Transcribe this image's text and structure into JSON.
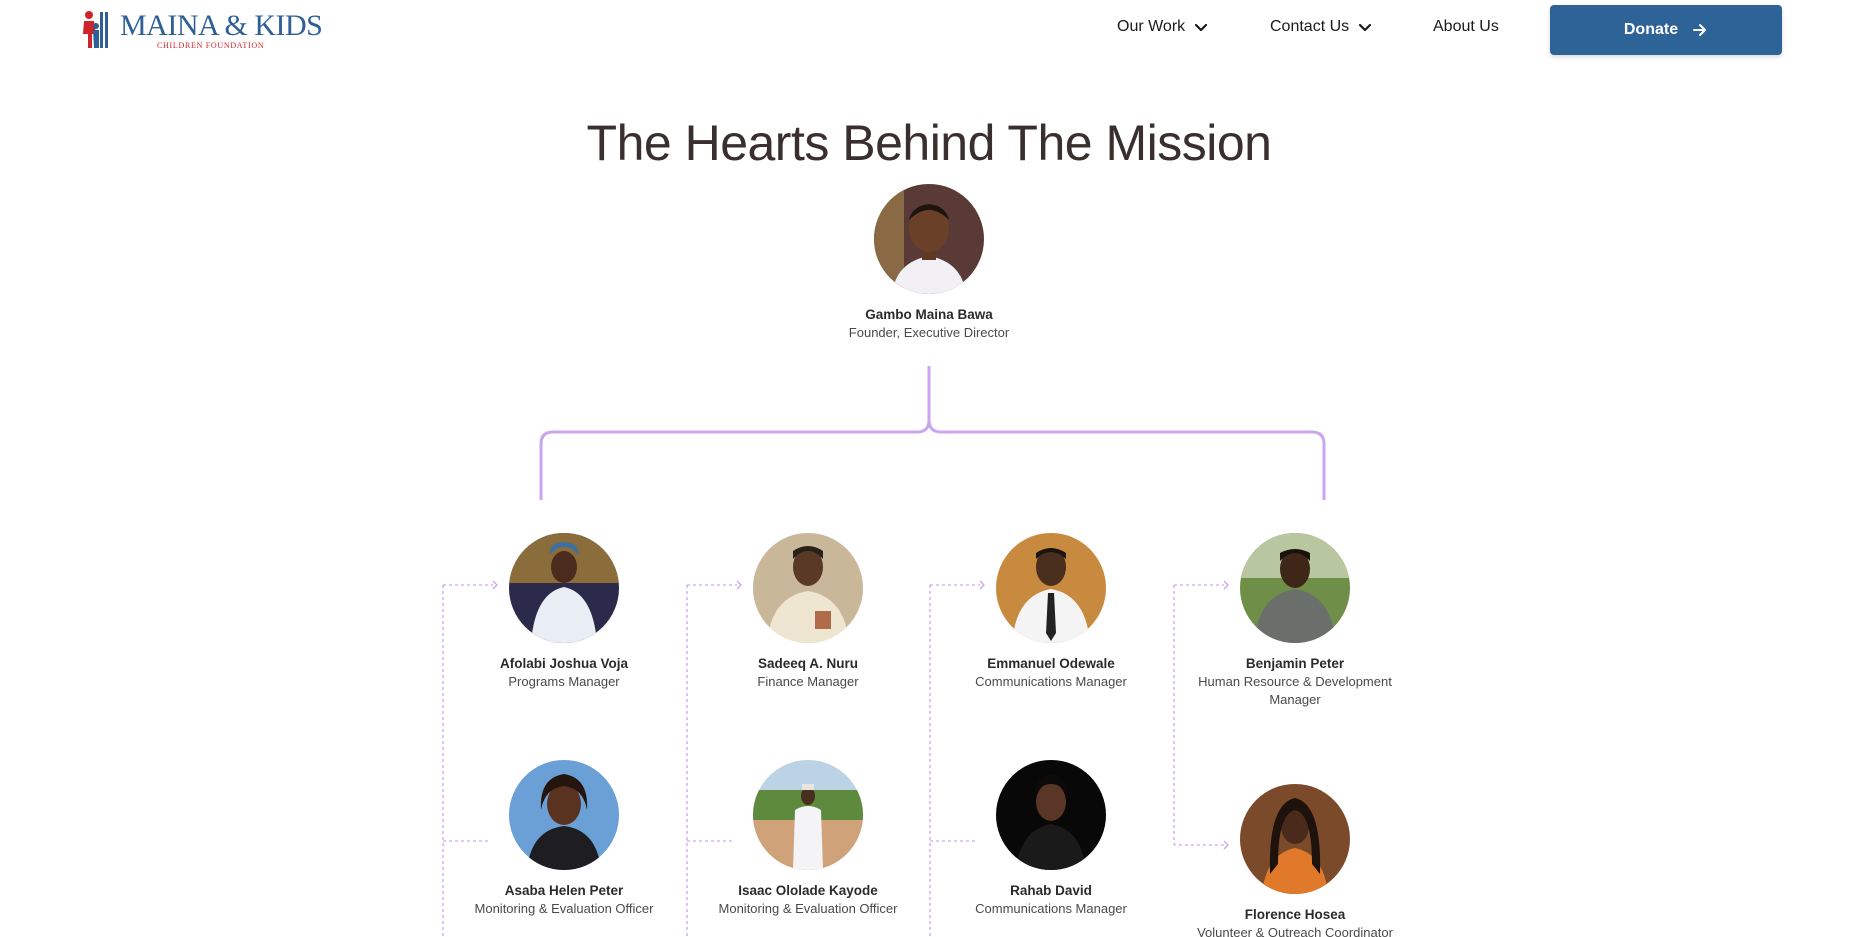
{
  "header": {
    "logo": {
      "title": "MAINA & KIDS",
      "subtitle": "CHILDREN FOUNDATION"
    },
    "nav": {
      "our_work": "Our Work",
      "contact_us": "Contact Us",
      "about_us": "About Us"
    },
    "donate_label": "Donate",
    "icons": {
      "dropdown": "chevron-down-icon",
      "donate": "arrow-right-icon"
    }
  },
  "page_title": "The Hearts Behind The Mission",
  "colors": {
    "brand_blue": "#2e6398",
    "brand_red": "#d1232a",
    "connector_purple": "#c9a6ef"
  },
  "founder": {
    "name": "Gambo Maina Bawa",
    "role": "Founder, Executive Director"
  },
  "team": [
    {
      "name": "Afolabi Joshua Voja",
      "role": "Programs Manager"
    },
    {
      "name": "Sadeeq A. Nuru",
      "role": "Finance Manager"
    },
    {
      "name": "Emmanuel Odewale",
      "role": "Communications Manager"
    },
    {
      "name": "Benjamin Peter",
      "role": "Human Resource & Development Manager"
    },
    {
      "name": "Asaba Helen Peter",
      "role": "Monitoring & Evaluation Officer"
    },
    {
      "name": "Isaac Ololade Kayode",
      "role": "Monitoring & Evaluation Officer"
    },
    {
      "name": "Rahab David",
      "role": "Communications Manager"
    },
    {
      "name": "Florence Hosea",
      "role": "Volunteer & Outreach Coordinator"
    }
  ]
}
